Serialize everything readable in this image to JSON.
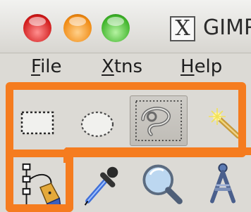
{
  "window": {
    "title": "GIMP",
    "app_icon_glyph": "X",
    "traffic_lights": [
      {
        "name": "close",
        "color": "#e0282a"
      },
      {
        "name": "minimize",
        "color": "#f39a21"
      },
      {
        "name": "zoom",
        "color": "#4cbf37"
      }
    ]
  },
  "menu": {
    "items": [
      {
        "accel": "F",
        "rest": "ile"
      },
      {
        "accel": "X",
        "rest": "tns"
      },
      {
        "accel": "H",
        "rest": "elp"
      }
    ]
  },
  "toolbox": {
    "tools": [
      {
        "icon": "rect-select-icon",
        "active": false
      },
      {
        "icon": "ellipse-select-icon",
        "active": false
      },
      {
        "icon": "free-select-icon",
        "active": true
      },
      {
        "icon": "fuzzy-select-icon",
        "active": false
      },
      {
        "icon": "paths-tool-icon",
        "active": false
      },
      {
        "icon": "color-picker-icon",
        "active": false
      },
      {
        "icon": "zoom-tool-icon",
        "active": false
      },
      {
        "icon": "measure-tool-icon",
        "active": false
      }
    ]
  },
  "highlight": {
    "color": "#f57c1f"
  }
}
